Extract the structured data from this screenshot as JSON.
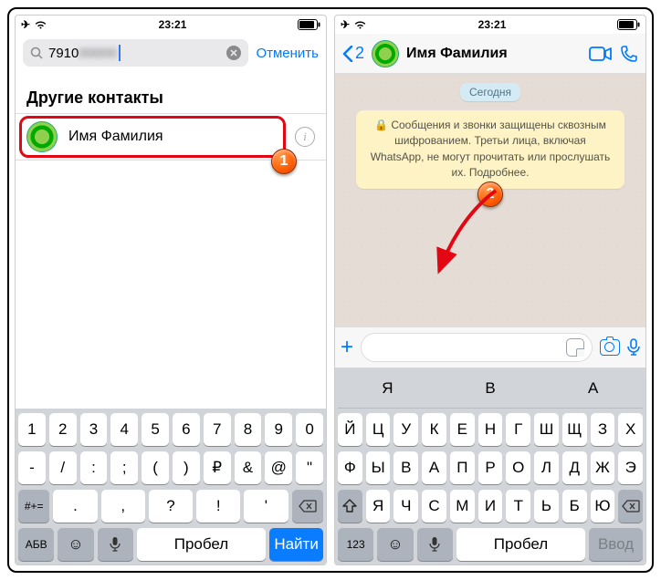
{
  "status": {
    "time": "23:21"
  },
  "left": {
    "search": {
      "value": "7910",
      "cancel": "Отменить"
    },
    "section": "Другие контакты",
    "contact": {
      "name": "Имя Фамилия"
    },
    "kbd": {
      "r1": [
        "1",
        "2",
        "3",
        "4",
        "5",
        "6",
        "7",
        "8",
        "9",
        "0"
      ],
      "r2": [
        "-",
        "/",
        ":",
        ";",
        "(",
        ")",
        "₽",
        "&",
        "@",
        "\""
      ],
      "r3mid": [
        ".",
        ",",
        "?",
        "!",
        "'"
      ],
      "sym": "#+=",
      "abc": "АБВ",
      "space": "Пробел",
      "find": "Найти"
    },
    "badge": "1"
  },
  "right": {
    "back": "2",
    "title": "Имя Фамилия",
    "day": "Сегодня",
    "enc": "🔒 Сообщения и звонки защищены сквозным шифрованием. Третьи лица, включая WhatsApp, не могут прочитать или прослушать их. Подробнее.",
    "kbd": {
      "sugg": [
        "Я",
        "В",
        "А"
      ],
      "r1": [
        "Й",
        "Ц",
        "У",
        "К",
        "Е",
        "Н",
        "Г",
        "Ш",
        "Щ",
        "З",
        "Х"
      ],
      "r2": [
        "Ф",
        "Ы",
        "В",
        "А",
        "П",
        "Р",
        "О",
        "Л",
        "Д",
        "Ж",
        "Э"
      ],
      "r3mid": [
        "Я",
        "Ч",
        "С",
        "М",
        "И",
        "Т",
        "Ь",
        "Б",
        "Ю"
      ],
      "num": "123",
      "space": "Пробел",
      "enter": "Ввод"
    },
    "badge": "2"
  }
}
